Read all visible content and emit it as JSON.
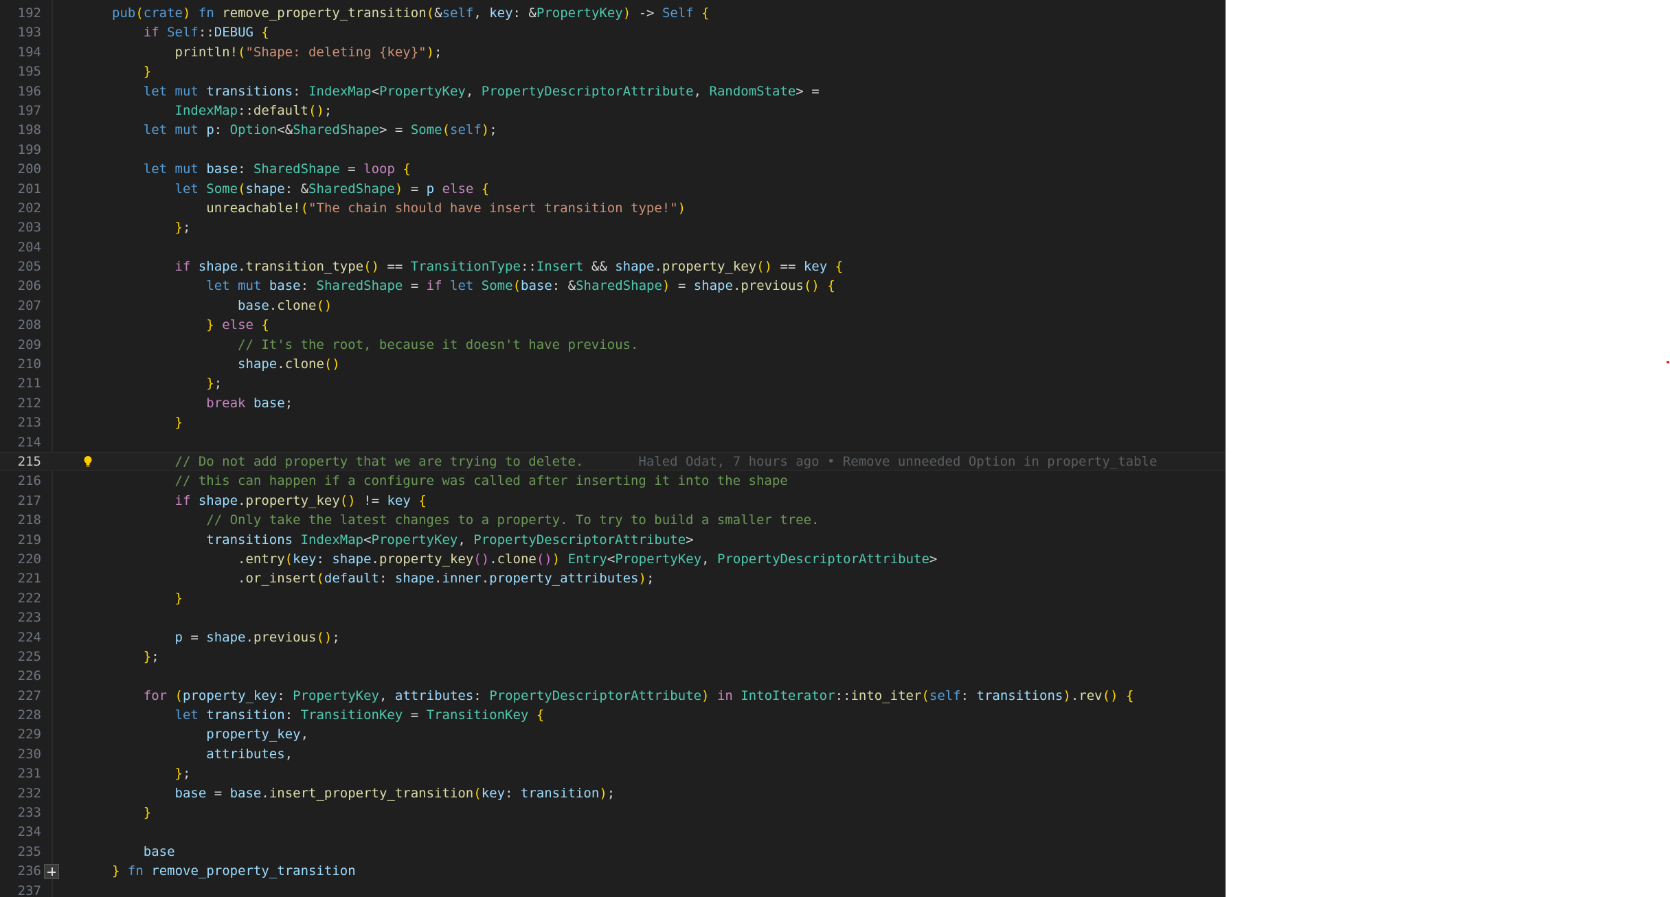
{
  "editor": {
    "current_line": 215,
    "lines": [
      {
        "n": "192",
        "code": "pub(crate) fn remove_property_transition(&self, key: &PropertyKey) -> Self {"
      },
      {
        "n": "193",
        "code": "    if Self::DEBUG {"
      },
      {
        "n": "194",
        "code": "        println!(\"Shape: deleting {key}\");"
      },
      {
        "n": "195",
        "code": "    }"
      },
      {
        "n": "196",
        "code": "    let mut transitions: IndexMap<PropertyKey, PropertyDescriptorAttribute, RandomState> ="
      },
      {
        "n": "197",
        "code": "        IndexMap::default();"
      },
      {
        "n": "198",
        "code": "    let mut p: Option<&SharedShape> = Some(self);"
      },
      {
        "n": "199",
        "code": ""
      },
      {
        "n": "200",
        "code": "    let mut base: SharedShape = loop {"
      },
      {
        "n": "201",
        "code": "        let Some(shape: &SharedShape) = p else {"
      },
      {
        "n": "202",
        "code": "            unreachable!(\"The chain should have insert transition type!\")"
      },
      {
        "n": "203",
        "code": "        };"
      },
      {
        "n": "204",
        "code": ""
      },
      {
        "n": "205",
        "code": "        if shape.transition_type() == TransitionType::Insert && shape.property_key() == key {"
      },
      {
        "n": "206",
        "code": "            let mut base: SharedShape = if let Some(base: &SharedShape) = shape.previous() {"
      },
      {
        "n": "207",
        "code": "                base.clone()"
      },
      {
        "n": "208",
        "code": "            } else {"
      },
      {
        "n": "209",
        "code": "                // It's the root, because it doesn't have previous."
      },
      {
        "n": "210",
        "code": "                shape.clone()"
      },
      {
        "n": "211",
        "code": "            };"
      },
      {
        "n": "212",
        "code": "            break base;"
      },
      {
        "n": "213",
        "code": "        }"
      },
      {
        "n": "214",
        "code": ""
      },
      {
        "n": "215",
        "code": "        // Do not add property that we are trying to delete.",
        "blame": "Haled Odat, 7 hours ago • Remove unneeded Option in property_table"
      },
      {
        "n": "216",
        "code": "        // this can happen if a configure was called after inserting it into the shape"
      },
      {
        "n": "217",
        "code": "        if shape.property_key() != key {"
      },
      {
        "n": "218",
        "code": "            // Only take the latest changes to a property. To try to build a smaller tree."
      },
      {
        "n": "219",
        "code": "            transitions IndexMap<PropertyKey, PropertyDescriptorAttribute>"
      },
      {
        "n": "220",
        "code": "                .entry(key: shape.property_key().clone()) Entry<PropertyKey, PropertyDescriptorAttribute>"
      },
      {
        "n": "221",
        "code": "                .or_insert(default: shape.inner.property_attributes);"
      },
      {
        "n": "222",
        "code": "        }"
      },
      {
        "n": "223",
        "code": ""
      },
      {
        "n": "224",
        "code": "        p = shape.previous();"
      },
      {
        "n": "225",
        "code": "    };"
      },
      {
        "n": "226",
        "code": ""
      },
      {
        "n": "227",
        "code": "    for (property_key: PropertyKey, attributes: PropertyDescriptorAttribute) in IntoIterator::into_iter(self: transitions).rev() {"
      },
      {
        "n": "228",
        "code": "        let transition: TransitionKey = TransitionKey {"
      },
      {
        "n": "229",
        "code": "            property_key,"
      },
      {
        "n": "230",
        "code": "            attributes,"
      },
      {
        "n": "231",
        "code": "        };"
      },
      {
        "n": "232",
        "code": "        base = base.insert_property_transition(key: transition);"
      },
      {
        "n": "233",
        "code": "    }"
      },
      {
        "n": "234",
        "code": ""
      },
      {
        "n": "235",
        "code": "    base"
      },
      {
        "n": "236",
        "code": "} fn remove_property_transition"
      },
      {
        "n": "237",
        "code": ""
      }
    ]
  },
  "icons": {
    "lightbulb": "lightbulb-icon",
    "fold": "fold-expand-icon"
  },
  "colors": {
    "editor_bg": "#1f1f1f",
    "keyword": "#569cd6",
    "control": "#c586c0",
    "function": "#dcdcaa",
    "type": "#4ec9b0",
    "variable": "#9cdcfe",
    "string": "#ce9178",
    "comment": "#6a9955"
  }
}
